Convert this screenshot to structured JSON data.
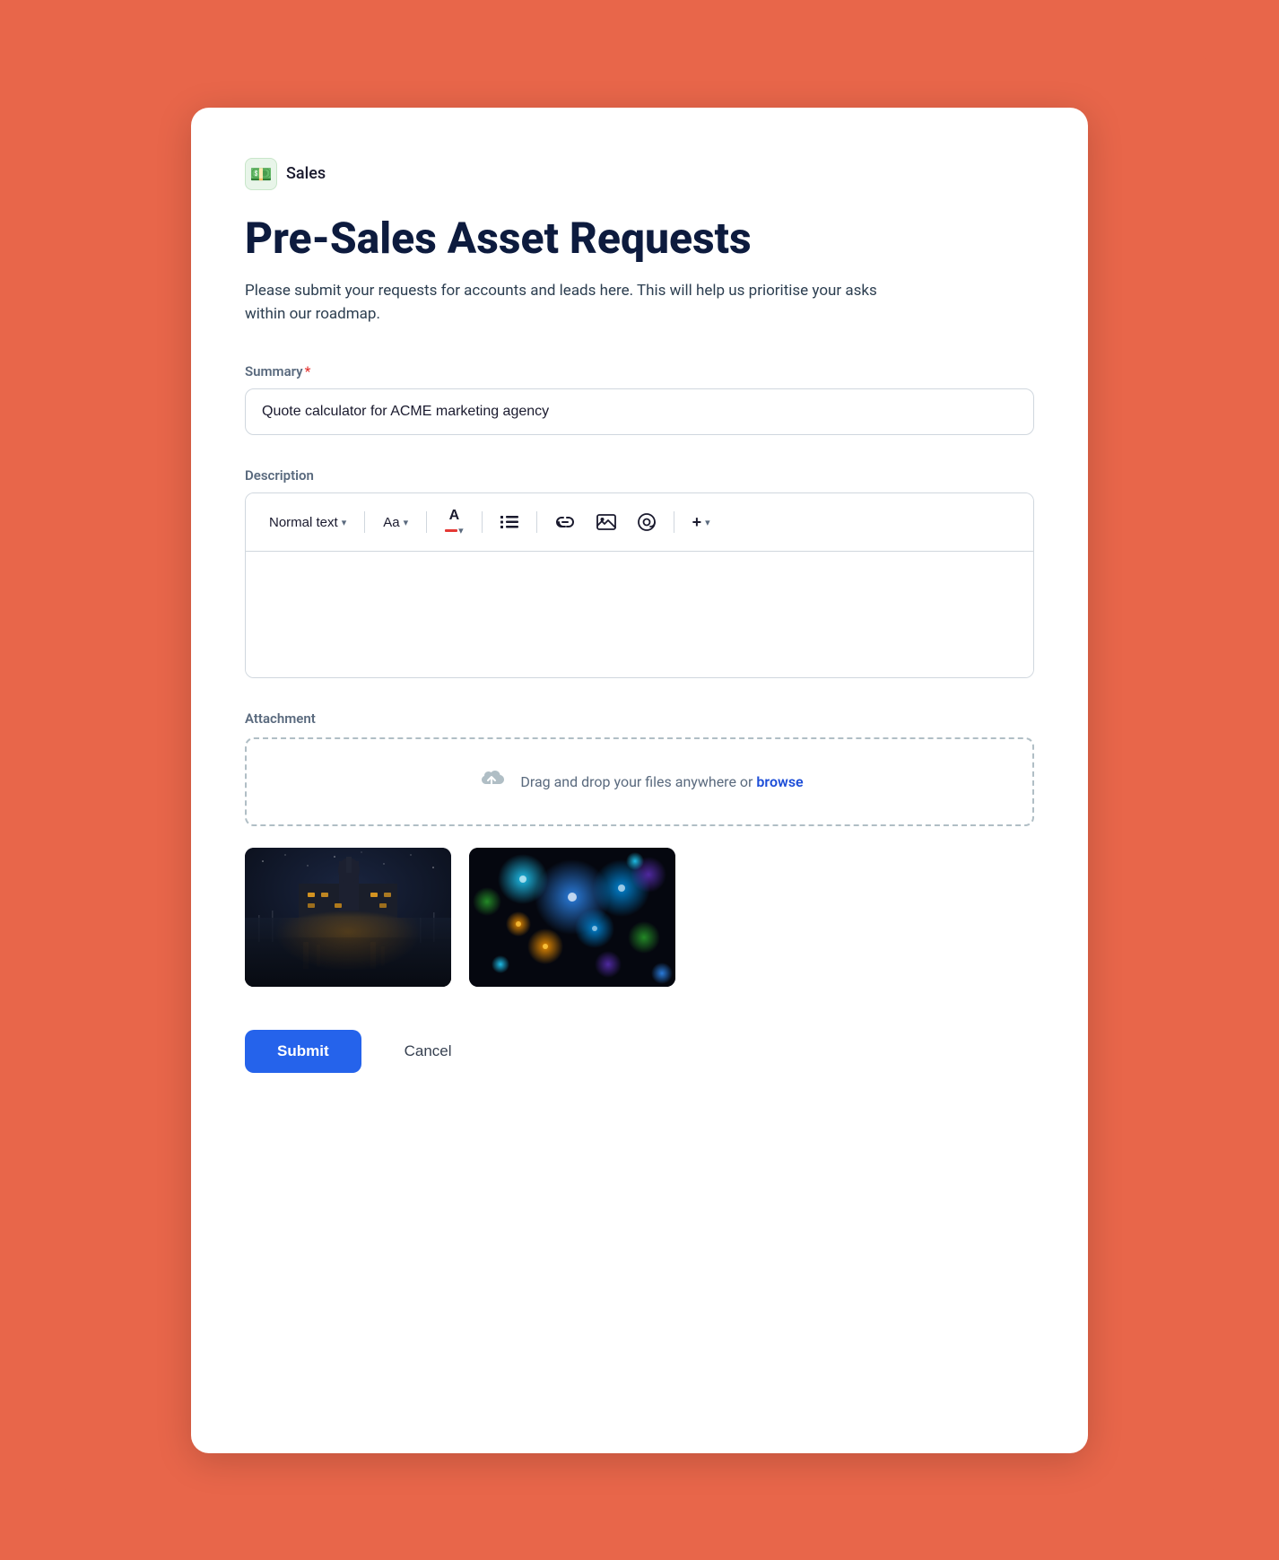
{
  "app": {
    "icon": "💵",
    "name": "Sales"
  },
  "page": {
    "title": "Pre-Sales Asset Requests",
    "description": "Please submit your requests for accounts and leads here. This will help us prioritise your asks within our roadmap."
  },
  "form": {
    "summary_label": "Summary",
    "summary_required": true,
    "summary_value": "Quote calculator for ACME marketing agency",
    "summary_placeholder": "",
    "description_label": "Description",
    "attachment_label": "Attachment",
    "drop_text": "Drag and drop your files anywhere or",
    "browse_text": "browse"
  },
  "toolbar": {
    "text_style_label": "Normal text",
    "font_size_label": "Aa",
    "list_icon": "≡",
    "link_icon": "🔗",
    "image_icon": "🖼",
    "mention_icon": "@",
    "more_icon": "+"
  },
  "actions": {
    "submit_label": "Submit",
    "cancel_label": "Cancel"
  },
  "colors": {
    "primary": "#2563eb",
    "required_star": "#e53935",
    "border": "#d0d7de",
    "label": "#5a6a7e",
    "title": "#0d1b3e",
    "browse_link": "#1d4ed8",
    "background_outer": "#E8664A"
  }
}
